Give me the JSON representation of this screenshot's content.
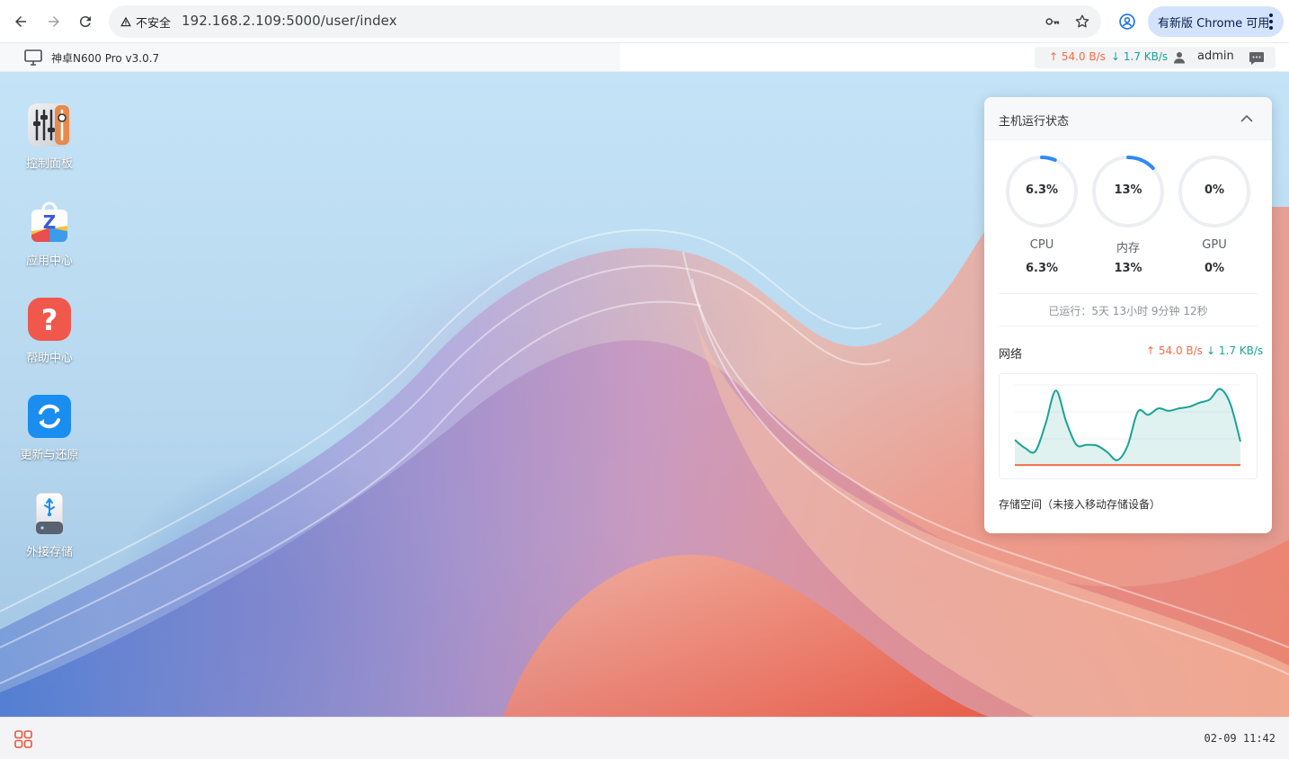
{
  "browser": {
    "security_label": "不安全",
    "url": "192.168.2.109:5000/user/index",
    "update_label": "有新版 Chrome 可用"
  },
  "header": {
    "app_title": "神卓N600 Pro v3.0.7",
    "upload_speed": "↑ 54.0 B/s",
    "download_speed": "↓ 1.7 KB/s",
    "username": "admin"
  },
  "desktop": {
    "icons": [
      {
        "label": "控制面板",
        "icon": "control-panel-icon"
      },
      {
        "label": "应用中心",
        "icon": "app-center-icon"
      },
      {
        "label": "帮助中心",
        "icon": "help-center-icon"
      },
      {
        "label": "更新与还原",
        "icon": "update-restore-icon"
      },
      {
        "label": "外接存储",
        "icon": "external-storage-icon"
      }
    ]
  },
  "status": {
    "title": "主机运行状态",
    "gauges": [
      {
        "name": "CPU",
        "value": "6.3%",
        "sub": "6.3%",
        "percent": 6.3
      },
      {
        "name": "内存",
        "value": "13%",
        "sub": "13%",
        "percent": 13
      },
      {
        "name": "GPU",
        "value": "0%",
        "sub": "0%",
        "percent": 0
      }
    ],
    "uptime": "已运行：5天 13小时 9分钟 12秒",
    "network": {
      "title": "网络",
      "upload": "↑ 54.0 B/s",
      "download": "↓ 1.7 KB/s"
    },
    "storage": "存储空间（未接入移动存储设备）"
  },
  "chart_data": {
    "type": "area",
    "series": [
      {
        "values": [
          0.32,
          0.22,
          0.18,
          0.52,
          0.93,
          0.55,
          0.26,
          0.26,
          0.25,
          0.17,
          0.07,
          0.25,
          0.67,
          0.63,
          0.71,
          0.68,
          0.71,
          0.73,
          0.78,
          0.82,
          0.95,
          0.77,
          0.3
        ]
      },
      {
        "values": [
          0.01,
          0.01,
          0.01,
          0.01,
          0.01,
          0.01,
          0.01,
          0.01,
          0.01,
          0.01,
          0.01,
          0.01,
          0.01,
          0.01,
          0.01,
          0.01,
          0.01,
          0.01,
          0.01,
          0.01,
          0.01,
          0.01,
          0.01
        ]
      }
    ],
    "colors": {
      "download": "#1aa394",
      "upload": "#f56c43"
    },
    "grid": true
  },
  "taskbar": {
    "clock": "02-09 11:42"
  },
  "theme": {
    "gauge_track": "#eceef2",
    "gauge_fill": "#2f8af5"
  }
}
